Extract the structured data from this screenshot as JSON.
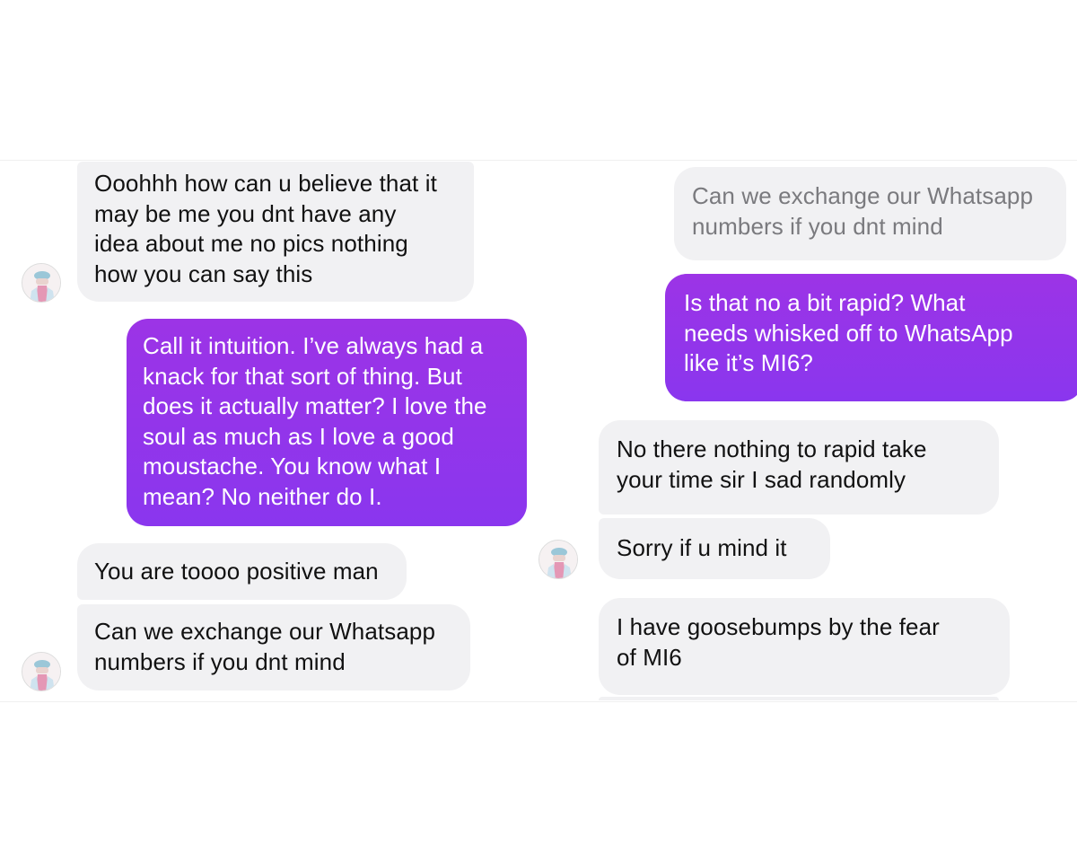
{
  "left_panel": {
    "messages": [
      {
        "sender": "them",
        "text": "Ooohhh how can u believe that it\nmay be me you dnt have any\nidea about me no pics nothing\nhow you can say this"
      },
      {
        "sender": "me",
        "text": "Call it intuition. I’ve always had a\nknack for that sort of thing. But\ndoes it actually matter? I love the\nsoul as much as I love a good\nmoustache. You know what I\nmean? No neither do I."
      },
      {
        "sender": "them",
        "text": "You are toooo positive man"
      },
      {
        "sender": "them",
        "text": "Can we exchange our Whatsapp\nnumbers if you dnt mind"
      }
    ]
  },
  "right_panel": {
    "messages": [
      {
        "sender": "them",
        "text": "Can we exchange our Whatsapp\nnumbers if you dnt mind"
      },
      {
        "sender": "me",
        "text": "Is that no a bit rapid? What\nneeds whisked off to WhatsApp\nlike it’s MI6?"
      },
      {
        "sender": "them",
        "text": "No there nothing to rapid take\nyour time sir I sad randomly"
      },
      {
        "sender": "them",
        "text": "Sorry if u mind it"
      },
      {
        "sender": "them",
        "text": "I have goosebumps by the fear\nof MI6"
      }
    ]
  },
  "colors": {
    "incoming_bubble": "#f1f1f3",
    "outgoing_bubble_top": "#9c34e6",
    "outgoing_bubble_bottom": "#8a36ee",
    "incoming_text": "#111111",
    "outgoing_text": "#ffffff"
  },
  "icons": {
    "avatar": "contact-avatar"
  }
}
